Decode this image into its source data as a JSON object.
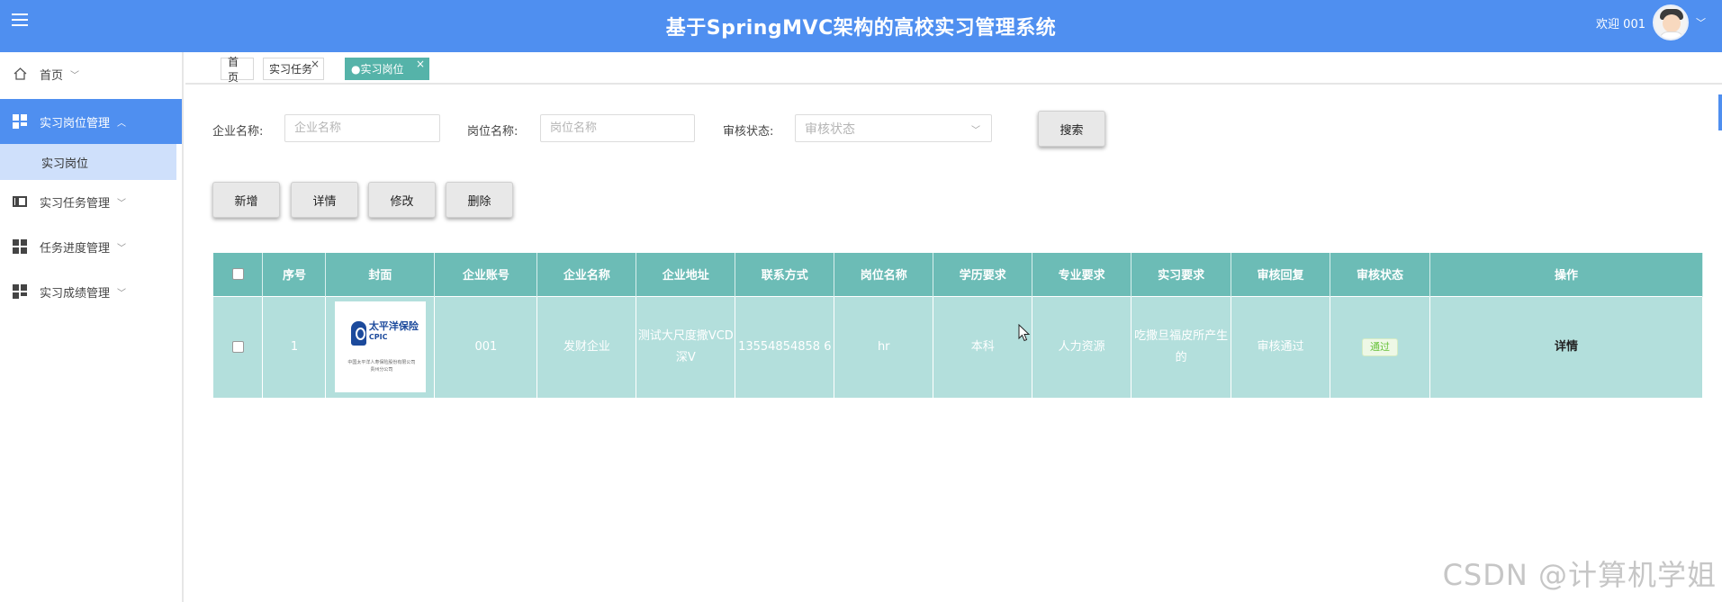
{
  "header": {
    "title": "基于SpringMVC架构的高校实习管理系统",
    "welcome": "欢迎 001",
    "color": "#4f8ff0"
  },
  "sidebar": {
    "items": [
      {
        "label": "首页",
        "icon": "home-icon"
      },
      {
        "label": "实习岗位管理",
        "icon": "dashboard-icon",
        "active": true
      },
      {
        "label": "实习任务管理",
        "icon": "film-icon"
      },
      {
        "label": "任务进度管理",
        "icon": "grid-icon"
      },
      {
        "label": "实习成绩管理",
        "icon": "dashboard-icon"
      }
    ],
    "sub_item": "实习岗位"
  },
  "tabs": [
    {
      "label": "首页"
    },
    {
      "label": "实习任务",
      "close": "×"
    },
    {
      "label": "●实习岗位",
      "close": "×",
      "current": true
    }
  ],
  "search": {
    "company_label": "企业名称:",
    "company_placeholder": "企业名称",
    "position_label": "岗位名称:",
    "position_placeholder": "岗位名称",
    "status_label": "审核状态:",
    "status_placeholder": "审核状态",
    "search_button": "搜索"
  },
  "actions": {
    "add": "新增",
    "detail": "详情",
    "edit": "修改",
    "delete": "删除"
  },
  "table": {
    "headers": [
      "序号",
      "封面",
      "企业账号",
      "企业名称",
      "企业地址",
      "联系方式",
      "岗位名称",
      "学历要求",
      "专业要求",
      "实习要求",
      "审核回复",
      "审核状态",
      "操作"
    ],
    "rows": [
      {
        "index": "1",
        "cover": {
          "brand_cn": "太平洋保险",
          "brand_en": "CPIC",
          "fine_print": "中国太平洋人寿保险股份有限公司 贵州分公司"
        },
        "account": "001",
        "company": "发财企业",
        "address": "测试大尺度撒VCD深V",
        "phone": "13554854858 6",
        "position": "hr",
        "education": "本科",
        "major": "人力资源",
        "requirement": "吃撒旦福皮所产生的",
        "reply": "审核通过",
        "status": "通过",
        "action": "详情"
      }
    ],
    "header_color": "#6cbcb6",
    "row_color": "#b3dfdc"
  },
  "watermark": "CSDN @计算机学姐"
}
